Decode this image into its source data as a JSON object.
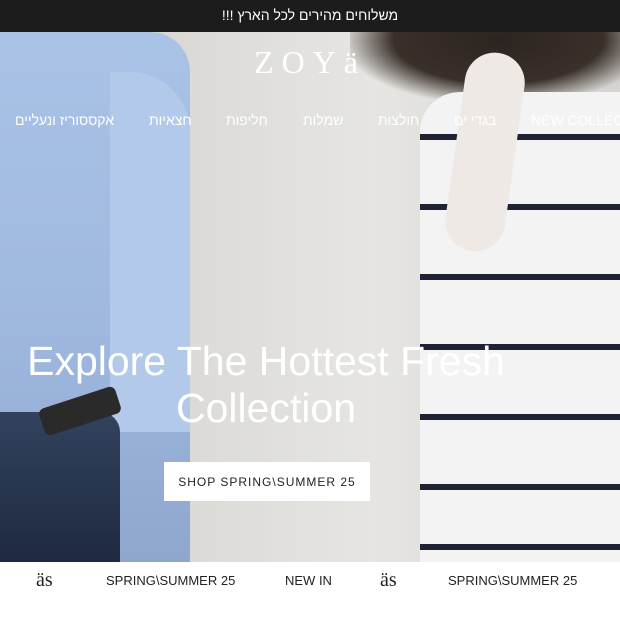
{
  "announcement": {
    "text": "משלוחים מהירים לכל הארץ !!!"
  },
  "header": {
    "logo": "ZOYä",
    "nav": [
      {
        "label": "NEW COLLECTION"
      },
      {
        "label": "בגדי ים"
      },
      {
        "label": "חולצות"
      },
      {
        "label": "שמלות"
      },
      {
        "label": "חליפות"
      },
      {
        "label": "חצאיות"
      },
      {
        "label": "אקססוריז ונעליים"
      }
    ]
  },
  "hero": {
    "headline_line1": "Explore The Hottest Fresh",
    "headline_line2": "Collection",
    "cta_label": "SHOP SPRING\\SUMMER 25"
  },
  "ticker": {
    "mark": "äs",
    "items": [
      "SPRING\\SUMMER 25",
      "NEW IN",
      "SPRING\\SUMMER 25"
    ]
  },
  "colors": {
    "topbar_bg": "#1c1c1c",
    "text_dark": "#222222",
    "white": "#ffffff"
  }
}
